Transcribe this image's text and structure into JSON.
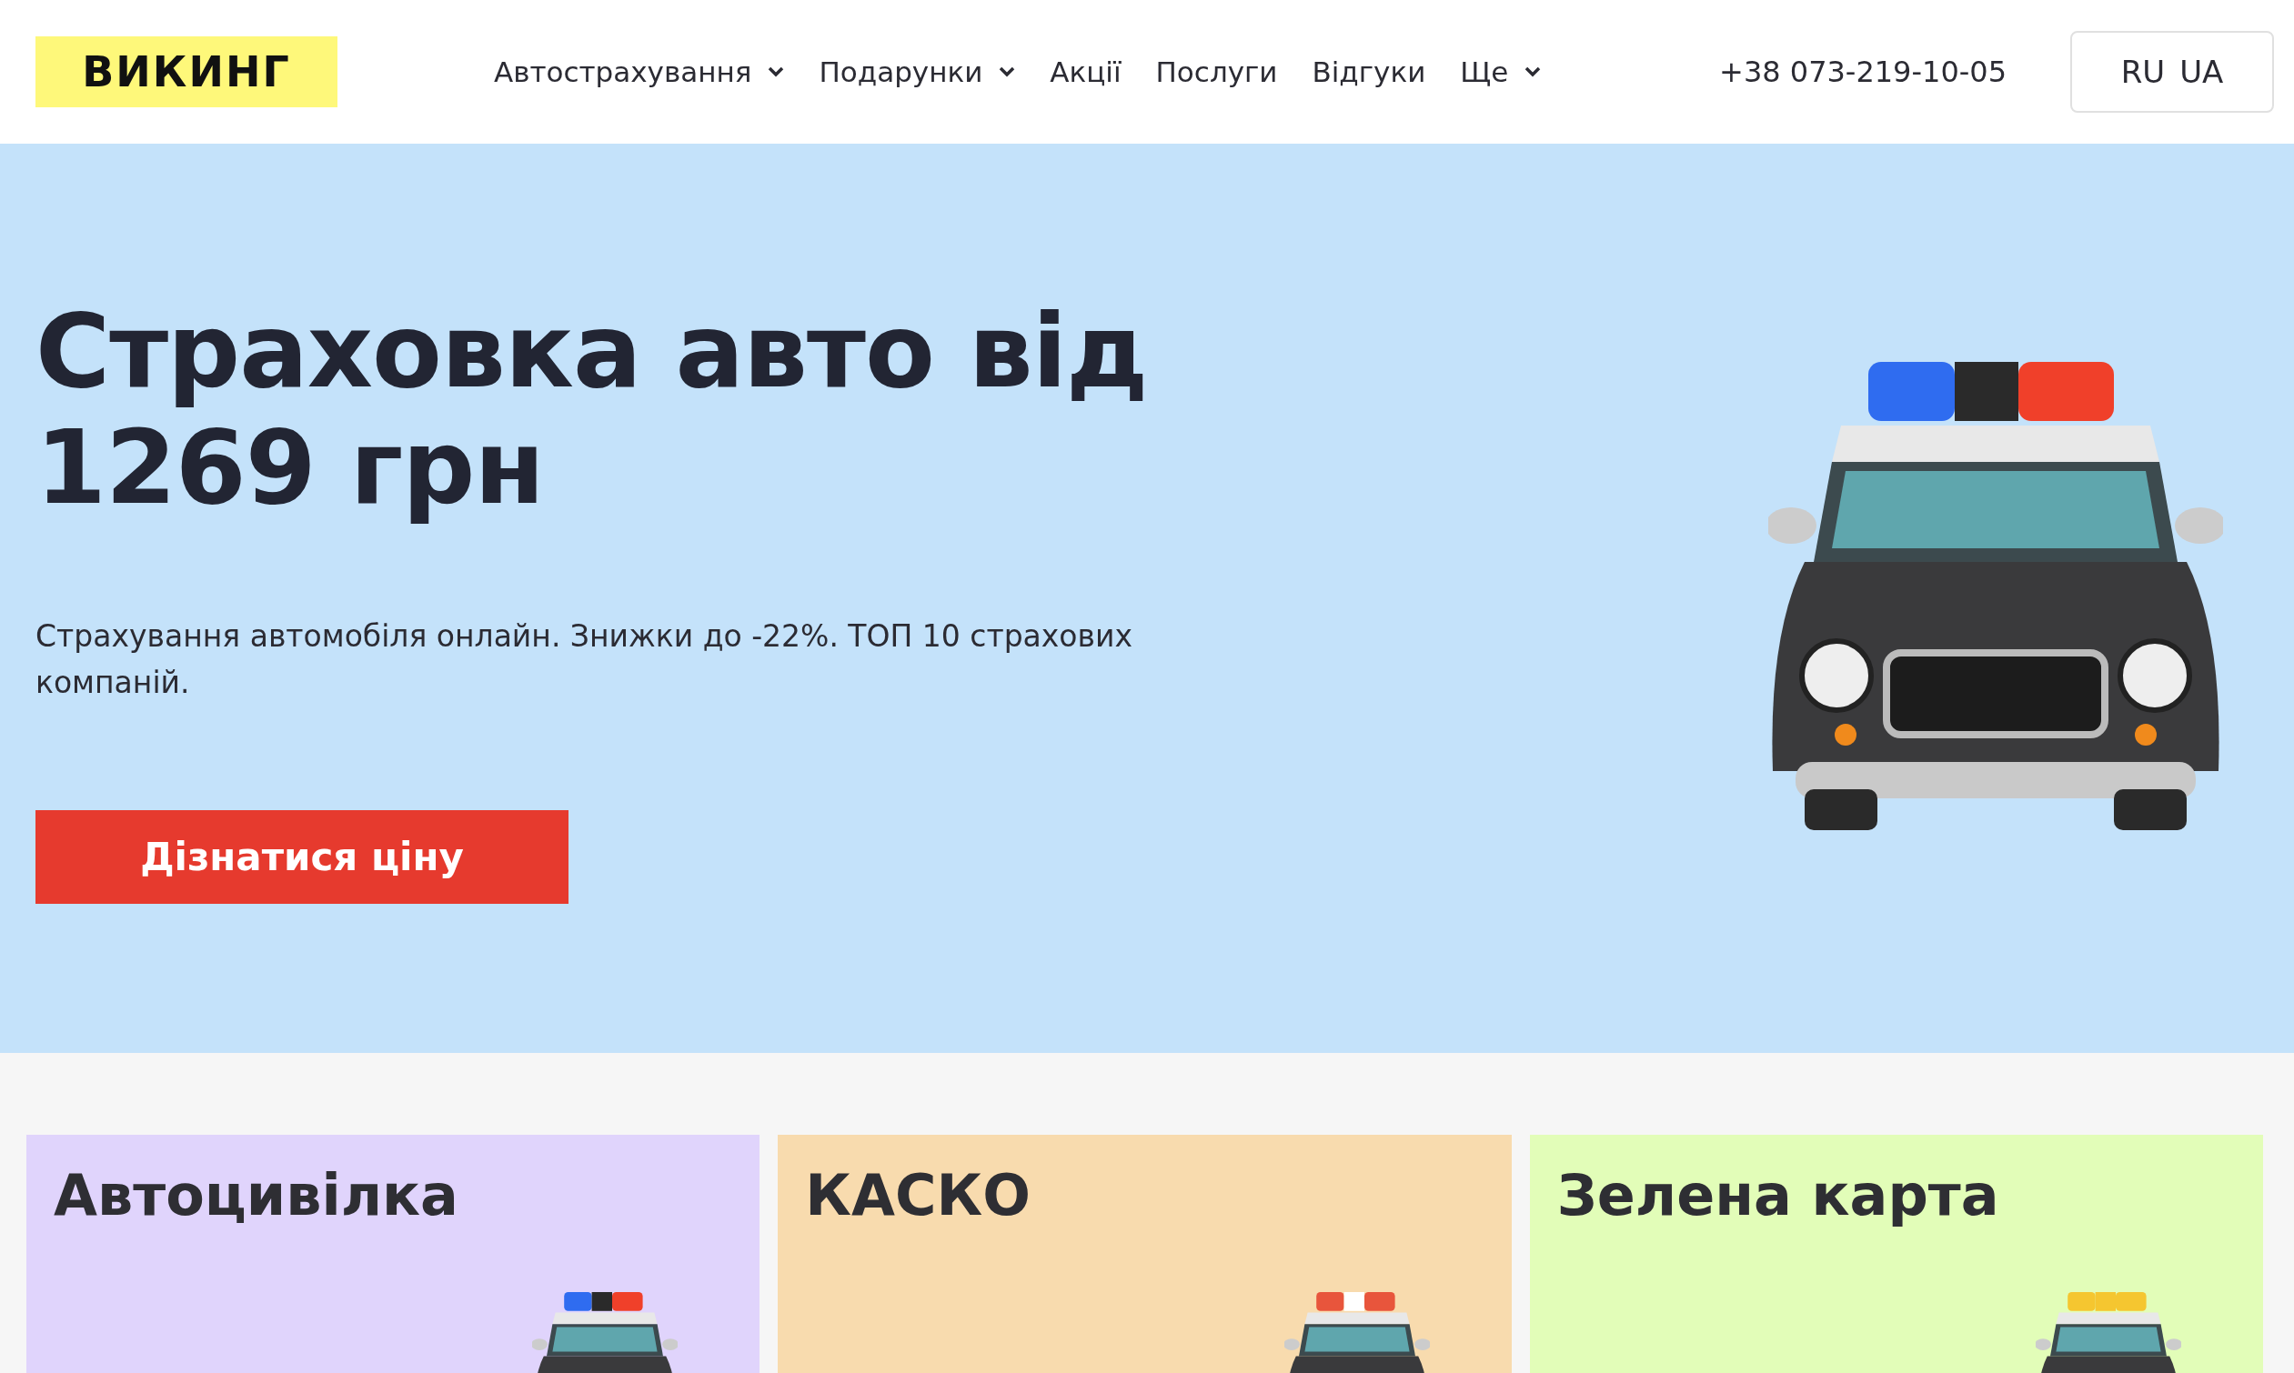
{
  "header": {
    "logo": "ВИКИНГ",
    "nav": [
      {
        "label": "Автострахування",
        "has_menu": true
      },
      {
        "label": "Подарунки",
        "has_menu": true
      },
      {
        "label": "Акції",
        "has_menu": false
      },
      {
        "label": "Послуги",
        "has_menu": false
      },
      {
        "label": "Відгуки",
        "has_menu": false
      },
      {
        "label": "Ще",
        "has_menu": true
      }
    ],
    "phone": "+38 073-219-10-05",
    "languages": [
      "RU",
      "UA"
    ]
  },
  "hero": {
    "title": "Страховка авто від 1269 грн",
    "subtitle": "Страхування автомобіля онлайн. Знижки до -22%. ТОП 10 страхових компаній.",
    "button": "Дізнатися ціну"
  },
  "cards": [
    {
      "title": "Автоцивілка",
      "color": "#e0d4fc",
      "kind": "police"
    },
    {
      "title": "КАСКО",
      "color": "#f8dbae",
      "kind": "fire"
    },
    {
      "title": "Зелена карта",
      "color": "#e2fdb8",
      "kind": "taxi"
    }
  ]
}
